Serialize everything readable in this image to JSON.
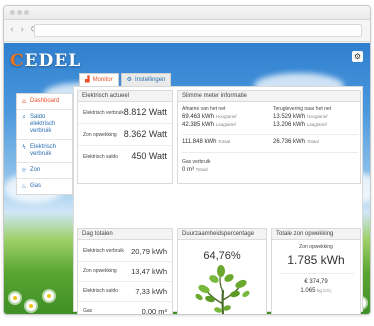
{
  "app": {
    "logo_text": "CEDEL"
  },
  "sidebar": {
    "items": [
      {
        "icon": "home-icon",
        "label": "Dashboard"
      },
      {
        "icon": "plug-icon",
        "label": "Saldo elektrisch verbruik"
      },
      {
        "icon": "bolt-icon",
        "label": "Elektrisch verbruik"
      },
      {
        "icon": "sun-icon",
        "label": "Zon"
      },
      {
        "icon": "flame-icon",
        "label": "Gas"
      }
    ]
  },
  "tabs": [
    {
      "icon": "chart-icon",
      "label": "Monitor"
    },
    {
      "icon": "gear-icon",
      "label": "Instellingen"
    }
  ],
  "elektrisch_actueel": {
    "title": "Elektrisch actueel",
    "rows": [
      {
        "label": "Elektrisch verbruik",
        "value": "8.812 Watt"
      },
      {
        "label": "Zon opwekking",
        "value": "8.362 Watt"
      },
      {
        "label": "Elektrisch saldo",
        "value": "450 Watt"
      }
    ]
  },
  "slimme_meter": {
    "title": "Slimme meter informatie",
    "afname_label": "Afname van het net",
    "teruglevering_label": "Teruglevering naar het net",
    "afname": [
      {
        "value": "69.463 kWh",
        "tariff": "Hoogtarief"
      },
      {
        "value": "42.385 kWh",
        "tariff": "Laagtarief"
      }
    ],
    "teruglevering": [
      {
        "value": "13.529 kWh",
        "tariff": "Hoogtarief"
      },
      {
        "value": "13.206 kWh",
        "tariff": "Laagtarief"
      }
    ],
    "afname_total": {
      "value": "111.848 kWh",
      "suffix": "Totaal"
    },
    "teruglevering_total": {
      "value": "26.736 kWh",
      "suffix": "Totaal"
    },
    "gas_label": "Gas verbruik",
    "gas_value": "0 m³",
    "gas_suffix": "Totaal"
  },
  "dag_totalen": {
    "title": "Dag totalen",
    "rows": [
      {
        "label": "Elektrisch verbruik",
        "value": "20,79 kWh"
      },
      {
        "label": "Zon opwekking",
        "value": "13,47 kWh"
      },
      {
        "label": "Elektrisch saldo",
        "value": "7,33 kWh"
      },
      {
        "label": "Gas",
        "value": "0,00 m³"
      }
    ]
  },
  "duurzaamheid": {
    "title": "Duurzaamheidspercentage",
    "value": "64,76%"
  },
  "totale_zon": {
    "title": "Totale zon opwekking",
    "subtitle": "Zon opwekking",
    "value": "1.785 kWh",
    "money": "€ 374,79",
    "co2_value": "1.065",
    "co2_unit": "kg CO₂"
  },
  "colors": {
    "accent": "#e8502a",
    "link": "#2a6fb0",
    "leaf": "#6aa82e",
    "trunk": "#4a6b2a"
  }
}
